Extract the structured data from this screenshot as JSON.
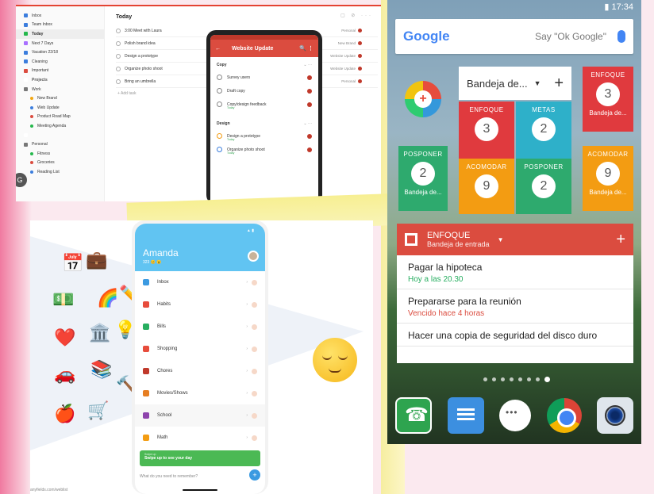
{
  "todoist_desktop": {
    "sidebar": [
      {
        "label": "Inbox",
        "color": "#3b7ddd",
        "sub": false
      },
      {
        "label": "Team Inbox",
        "color": "#3b7ddd",
        "sub": false
      },
      {
        "label": "Today",
        "color": "#25b84c",
        "sub": false,
        "active": true
      },
      {
        "label": "Next 7 Days",
        "color": "#a970ff",
        "sub": false
      },
      {
        "label": "Vacation 22/18",
        "color": "#3b7ddd",
        "sub": false
      },
      {
        "label": "Cleaning",
        "color": "#3b7ddd",
        "sub": false
      },
      {
        "label": "Important",
        "color": "#db4c3f",
        "sub": false
      },
      {
        "label": "Projects",
        "color": "#ffffff",
        "sub": false,
        "head": true
      },
      {
        "label": "Work",
        "color": "#777777",
        "sub": false
      },
      {
        "label": "New Brand",
        "color": "#f3a712",
        "sub": true
      },
      {
        "label": "Web Update",
        "color": "#3b7ddd",
        "sub": true
      },
      {
        "label": "Product Road Map",
        "color": "#db4c3f",
        "sub": true
      },
      {
        "label": "Meeting Agenda",
        "color": "#25b84c",
        "sub": true
      },
      {
        "label": "",
        "color": "#ffffff",
        "sub": false
      },
      {
        "label": "Personal",
        "color": "#777777",
        "sub": false
      },
      {
        "label": "Fitness",
        "color": "#25b84c",
        "sub": true
      },
      {
        "label": "Groceries",
        "color": "#db4c3f",
        "sub": true
      },
      {
        "label": "Reading List",
        "color": "#3b7ddd",
        "sub": true
      }
    ],
    "title": "Today",
    "top_icons": "▢ ⊘ ···",
    "tasks": [
      {
        "text": "3:00 Meet with Laura",
        "project": "Personal"
      },
      {
        "text": "Polish brand idea",
        "project": "New Brand"
      },
      {
        "text": "Design a prototype",
        "project": "Website Update"
      },
      {
        "text": "Organize photo shoot",
        "project": "Website Update"
      },
      {
        "text": "Bring an umbrella",
        "project": "Personal"
      }
    ],
    "add_task": "+ Add task",
    "google_icon": "G",
    "phone": {
      "title": "Website Update",
      "back": "←",
      "icons": "🔍 ⋮",
      "section1": "Copy",
      "section1_icons": "⌄ ···",
      "copy_tasks": [
        {
          "text": "Survey users",
          "sub": ""
        },
        {
          "text": "Draft copy",
          "sub": ""
        },
        {
          "text": "Copy/design feedback",
          "sub": "Today"
        }
      ],
      "section2": "Design",
      "section2_icons": "⌄ ···",
      "design_tasks": [
        {
          "text": "Design a prototype",
          "sub": "Today"
        },
        {
          "text": "Organize photo shoot",
          "sub": "Today"
        }
      ]
    }
  },
  "habit_app": {
    "name": "Amanda",
    "stats": "323 😊 😮",
    "status": "▲ ▮",
    "items": [
      {
        "label": "Inbox",
        "color": "#3b9ae1"
      },
      {
        "label": "Habits",
        "color": "#e74c3c"
      },
      {
        "label": "Bills",
        "color": "#27ae60"
      },
      {
        "label": "Shopping",
        "color": "#e74c3c"
      },
      {
        "label": "Chores",
        "color": "#c0392b"
      },
      {
        "label": "Movies/Shows",
        "color": "#e67e22"
      },
      {
        "label": "School",
        "color": "#8e44ad"
      },
      {
        "label": "Math",
        "color": "#f39c12"
      }
    ],
    "banner_small": "Swipe up",
    "banner_text": "Swipe up to see your day",
    "input_placeholder": "What do you need to remember?",
    "plus": "+",
    "url": "anyfields.com/weblist"
  },
  "doodles": [
    "📅",
    "💼",
    "💵",
    "🌈",
    "✏️",
    "❤️",
    "🏛️",
    "💡",
    "🚗",
    "📚",
    "🍎",
    "🛒",
    "🔨"
  ],
  "android": {
    "status": "▮ 17:34",
    "google_logo": "Google",
    "google_hint": "Say \"Ok Google\"",
    "todoist_plus": "+",
    "dropdown_label": "Bandeja de...",
    "dropdown_arrow": "▼",
    "dropdown_plus": "+",
    "tiles": [
      {
        "label": "ENFOQUE",
        "count": "3",
        "sub": "Bandeja de...",
        "color": "#e03a3e"
      },
      {
        "label": "ENFOQUE",
        "count": "3",
        "sub": "",
        "color": "#e03a3e"
      },
      {
        "label": "METAS",
        "count": "2",
        "sub": "",
        "color": "#2eb0c9"
      },
      {
        "label": "POSPONER",
        "count": "2",
        "sub": "Bandeja de...",
        "color": "#2eaa6e"
      },
      {
        "label": "ACOMODAR",
        "count": "9",
        "sub": "",
        "color": "#f39c12"
      },
      {
        "label": "POSPONER",
        "count": "2",
        "sub": "",
        "color": "#2eaa6e"
      },
      {
        "label": "ACOMODAR",
        "count": "9",
        "sub": "Bandeja de...",
        "color": "#f39c12"
      }
    ],
    "list_title": "ENFOQUE",
    "list_subtitle": "Bandeja de entrada",
    "list_arrow": "▼",
    "list_plus": "+",
    "list_items": [
      {
        "title": "Pagar la hipoteca",
        "sub": "Hoy a las 20.30",
        "tone": "green"
      },
      {
        "title": "Prepararse para la reunión",
        "sub": "Vencido hace 4 horas",
        "tone": "red"
      },
      {
        "title": "Hacer una copia de seguridad del disco duro",
        "sub": "",
        "tone": ""
      }
    ]
  }
}
